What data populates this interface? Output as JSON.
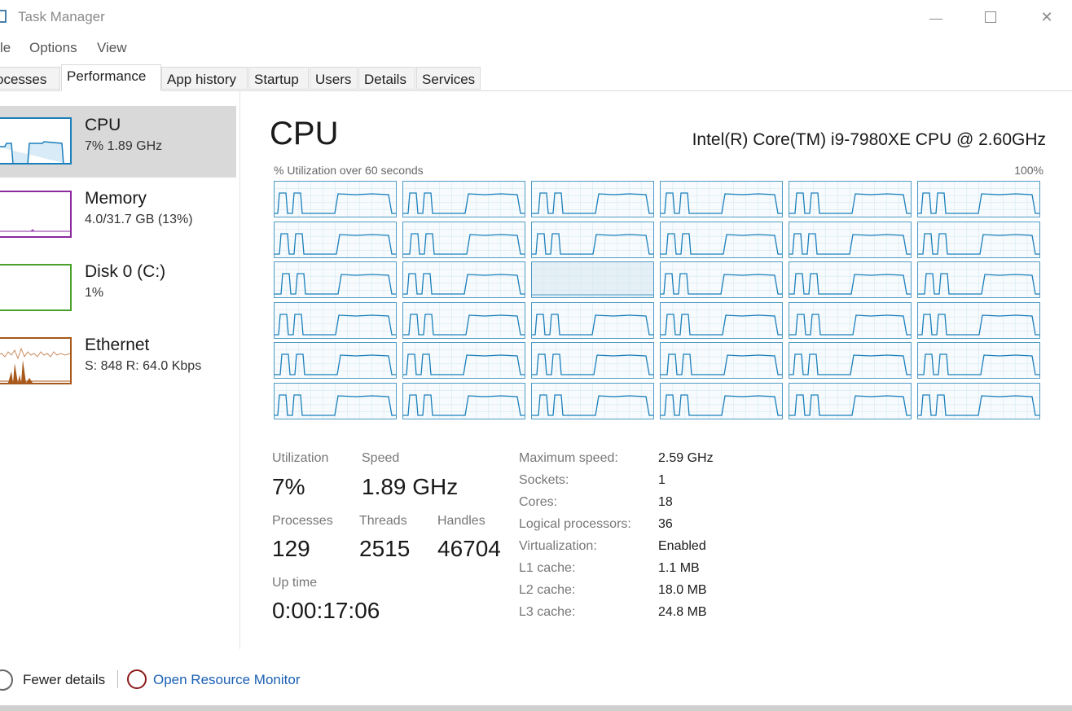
{
  "window": {
    "title": "Task Manager"
  },
  "menu": [
    "le",
    "Options",
    "View"
  ],
  "tabs": [
    "ocesses",
    "Performance",
    "App history",
    "Startup",
    "Users",
    "Details",
    "Services"
  ],
  "active_tab": "Performance",
  "sidebar": {
    "items": [
      {
        "name": "CPU",
        "sub": "7% 1.89 GHz",
        "color": "#1b7fbb"
      },
      {
        "name": "Memory",
        "sub": "4.0/31.7 GB (13%)",
        "color": "#8b2a9e"
      },
      {
        "name": "Disk 0 (C:)",
        "sub": "1%",
        "color": "#4aa02c"
      },
      {
        "name": "Ethernet",
        "sub": "S: 848  R: 64.0 Kbps",
        "color": "#a7581a"
      }
    ]
  },
  "main": {
    "title": "CPU",
    "model": "Intel(R) Core(TM) i9-7980XE CPU @ 2.60GHz",
    "graph_label": "% Utilization over 60 seconds",
    "graph_max": "100%",
    "logical_processor_graphs": 36,
    "graph_color": "#1b7fbb"
  },
  "stats": {
    "utilization_label": "Utilization",
    "utilization": "7%",
    "speed_label": "Speed",
    "speed": "1.89 GHz",
    "processes_label": "Processes",
    "processes": "129",
    "threads_label": "Threads",
    "threads": "2515",
    "handles_label": "Handles",
    "handles": "46704",
    "uptime_label": "Up time",
    "uptime": "0:00:17:06"
  },
  "specs": [
    {
      "key": "Maximum speed:",
      "value": "2.59 GHz"
    },
    {
      "key": "Sockets:",
      "value": "1"
    },
    {
      "key": "Cores:",
      "value": "18"
    },
    {
      "key": "Logical processors:",
      "value": "36"
    },
    {
      "key": "Virtualization:",
      "value": "Enabled"
    },
    {
      "key": "L1 cache:",
      "value": "1.1 MB"
    },
    {
      "key": "L2 cache:",
      "value": "18.0 MB"
    },
    {
      "key": "L3 cache:",
      "value": "24.8 MB"
    }
  ],
  "footer": {
    "fewer_details": "Fewer details",
    "open_resource_monitor": "Open Resource Monitor"
  }
}
